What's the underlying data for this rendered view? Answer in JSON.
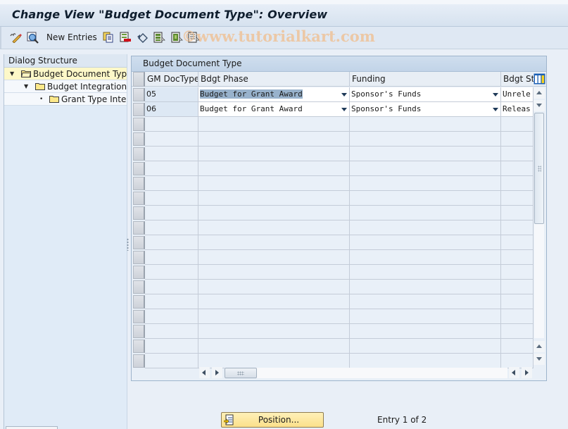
{
  "window": {
    "title": "Change View \"Budget Document Type\": Overview"
  },
  "toolbar": {
    "items": [
      {
        "name": "display-change-icon",
        "type": "icon"
      },
      {
        "name": "details-icon",
        "type": "icon"
      },
      {
        "name": "new-entries-button",
        "type": "text",
        "label": "New Entries"
      },
      {
        "name": "copy-as-icon",
        "type": "icon"
      },
      {
        "name": "delete-icon",
        "type": "icon"
      },
      {
        "name": "undo-change-icon",
        "type": "icon"
      },
      {
        "name": "select-all-icon",
        "type": "icon"
      },
      {
        "name": "select-block-icon",
        "type": "icon"
      },
      {
        "name": "deselect-all-icon",
        "type": "icon"
      }
    ],
    "watermark": "©www.tutorialkart.com"
  },
  "dialog_structure": {
    "header": "Dialog Structure",
    "items": [
      {
        "label": "Budget Document Type",
        "level": 0,
        "expanded": true,
        "selected": true,
        "icon": "folder-open-icon"
      },
      {
        "label": "Budget Integration t",
        "level": 1,
        "expanded": true,
        "selected": false,
        "icon": "folder-icon"
      },
      {
        "label": "Grant Type Inter",
        "level": 2,
        "expanded": false,
        "selected": false,
        "icon": "folder-icon"
      }
    ]
  },
  "table": {
    "caption": "Budget Document Type",
    "columns": [
      {
        "label": "GM DocType"
      },
      {
        "label": "Bdgt Phase"
      },
      {
        "label": "Funding"
      },
      {
        "label": "Bdgt St"
      }
    ],
    "rows": [
      {
        "doc_type": "05",
        "phase": "Budget for Grant Award",
        "funding": "Sponsor's Funds",
        "status": "Unrele"
      },
      {
        "doc_type": "06",
        "phase": "Budget for Grant Award",
        "funding": "Sponsor's Funds",
        "status": "Releas"
      }
    ],
    "empty_row_count": 17
  },
  "footer": {
    "position_button": "Position...",
    "entry_info": "Entry 1 of 2"
  }
}
